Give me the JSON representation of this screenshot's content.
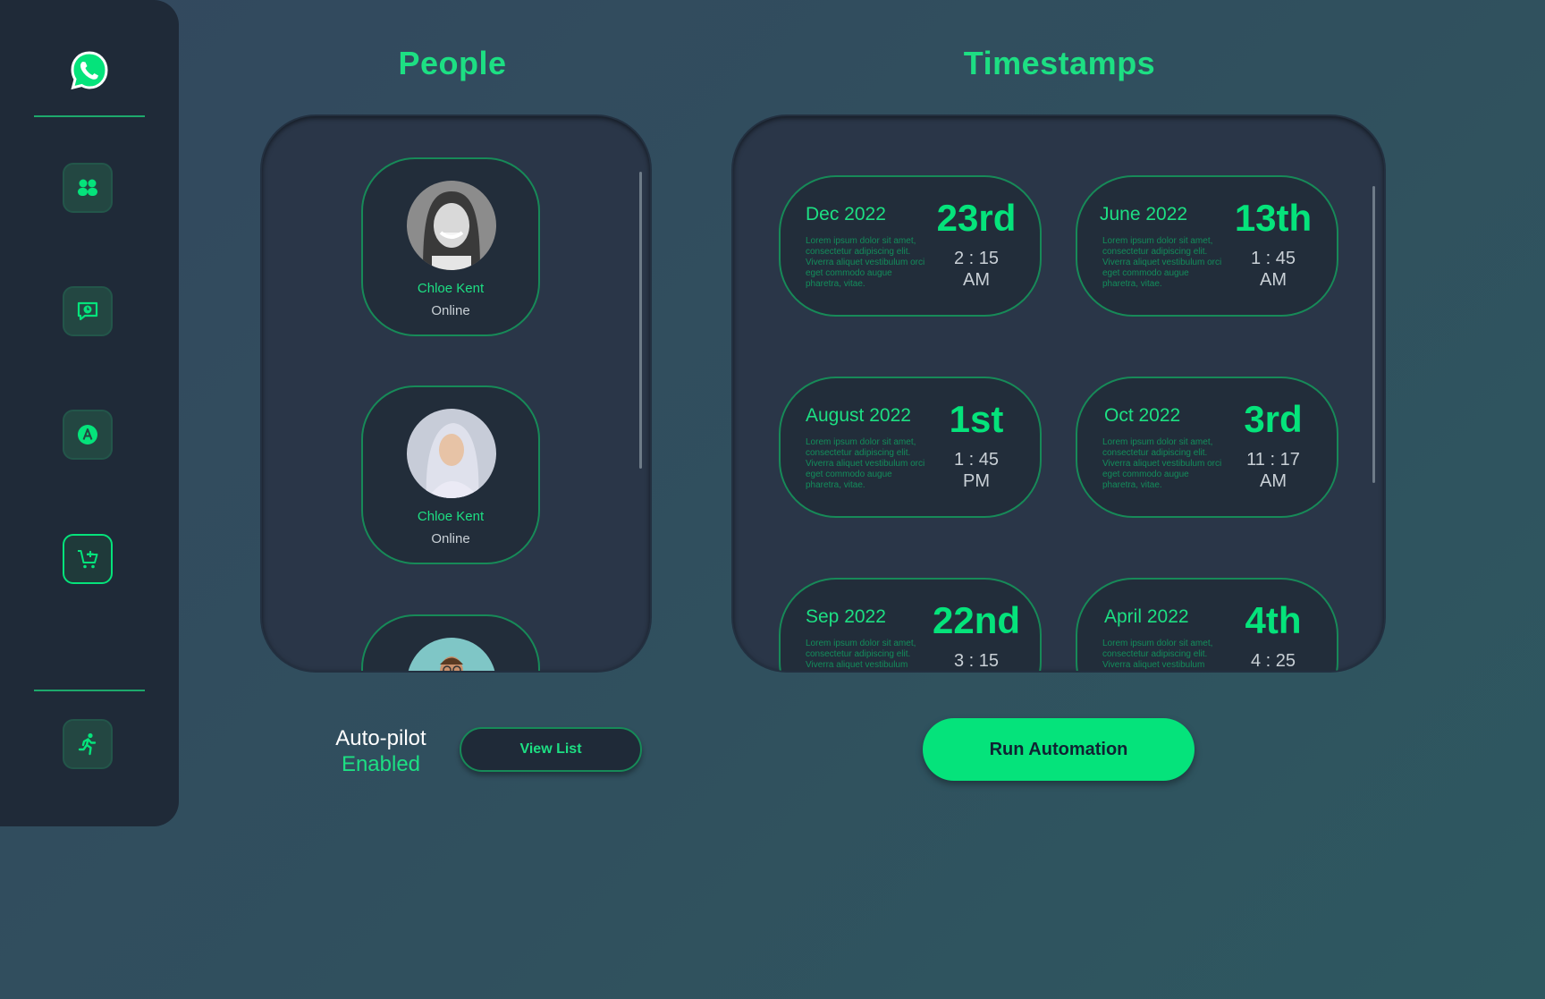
{
  "sidebar": {
    "logo_icon": "whatsapp-icon",
    "items": [
      {
        "icon": "users-icon",
        "active": false
      },
      {
        "icon": "chat-time-icon",
        "active": false
      },
      {
        "icon": "badge-a-icon",
        "active": false
      },
      {
        "icon": "cart-add-icon",
        "active": true
      }
    ],
    "exit_icon": "running-person-icon"
  },
  "people": {
    "title": "People",
    "list": [
      {
        "name": "Chloe Kent",
        "status": "Online"
      },
      {
        "name": "Chloe Kent",
        "status": "Online"
      },
      {
        "name": "",
        "status": ""
      }
    ]
  },
  "timestamps": {
    "title": "Timestamps",
    "list": [
      {
        "month": "Dec 2022",
        "day": "23rd",
        "time": "2 : 15",
        "ampm": "AM",
        "text": "Lorem ipsum dolor sit amet, consectetur adipiscing elit. Viverra aliquet vestibulum orci eget commodo augue pharetra, vitae."
      },
      {
        "month": "June 2022",
        "day": "13th",
        "time": "1 : 45",
        "ampm": "AM",
        "text": "Lorem ipsum dolor sit amet, consectetur adipiscing elit. Viverra aliquet vestibulum orci eget commodo augue pharetra, vitae."
      },
      {
        "month": "August 2022",
        "day": "1st",
        "time": "1 : 45",
        "ampm": "PM",
        "text": "Lorem ipsum dolor sit amet, consectetur adipiscing elit. Viverra aliquet vestibulum orci eget commodo augue pharetra, vitae."
      },
      {
        "month": "Oct 2022",
        "day": "3rd",
        "time": "11 : 17",
        "ampm": "AM",
        "text": "Lorem ipsum dolor sit amet, consectetur adipiscing elit. Viverra aliquet vestibulum orci eget commodo augue pharetra, vitae."
      },
      {
        "month": "Sep 2022",
        "day": "22nd",
        "time": "3 : 15",
        "ampm": "",
        "text": "Lorem ipsum dolor sit amet, consectetur adipiscing elit. Viverra aliquet vestibulum"
      },
      {
        "month": "April 2022",
        "day": "4th",
        "time": "4 : 25",
        "ampm": "",
        "text": "Lorem ipsum dolor sit amet, consectetur adipiscing elit. Viverra aliquet vestibulum"
      }
    ]
  },
  "autopilot": {
    "label": "Auto-pilot",
    "value": "Enabled"
  },
  "actions": {
    "view_list": "View List",
    "run": "Run Automation"
  },
  "colors": {
    "accent": "#05e37b",
    "sidebar": "#1f2a38",
    "panel": "#2a3648"
  }
}
